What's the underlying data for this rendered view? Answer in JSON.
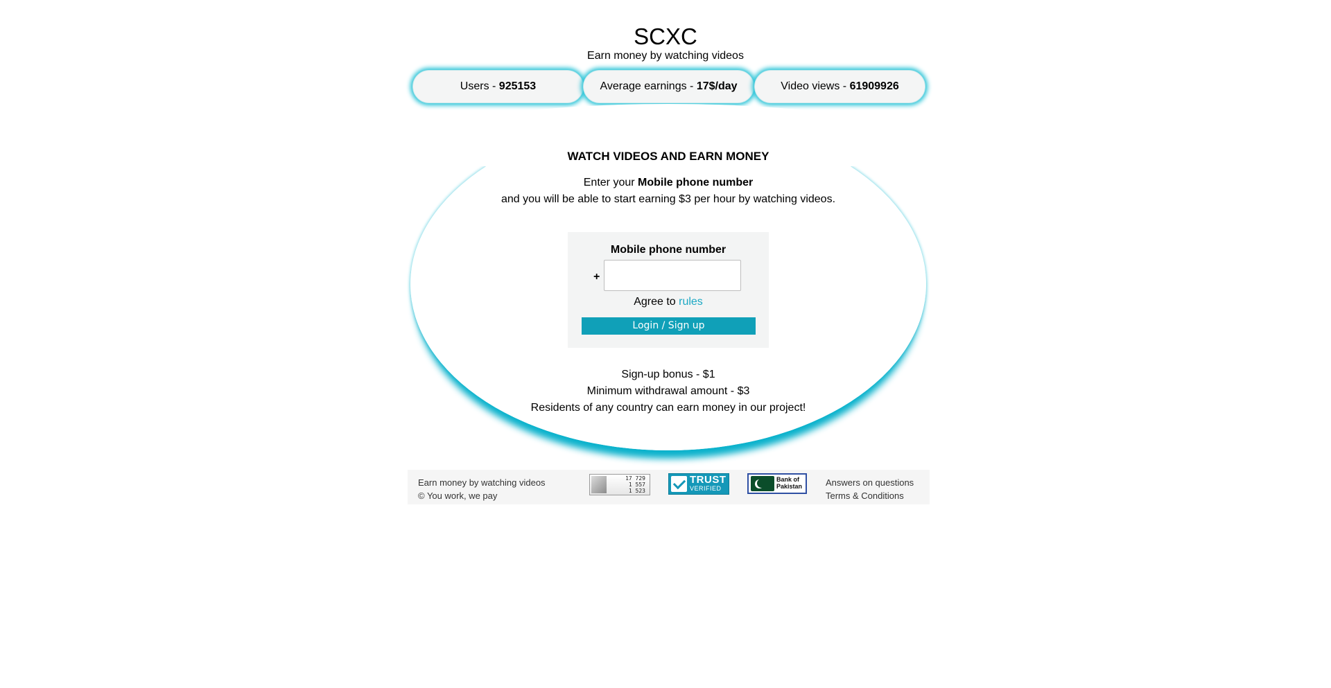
{
  "header": {
    "title": "SCXC",
    "subtitle": "Earn money by watching videos"
  },
  "stats": [
    {
      "label": "Users - ",
      "value": "925153"
    },
    {
      "label": "Average earnings - ",
      "value": "17$/day"
    },
    {
      "label": "Video views - ",
      "value": "61909926"
    }
  ],
  "promo": {
    "heading": "WATCH VIDEOS AND EARN MONEY",
    "intro_prefix": "Enter your ",
    "intro_bold": "Mobile phone number",
    "intro_line2": "and you will be able to start earning $3 per hour by watching videos."
  },
  "form": {
    "label": "Mobile phone number",
    "plus": "+",
    "phone_value": "",
    "agree_prefix": "Agree to ",
    "rules_link": "rules",
    "submit_label": "Login / Sign up"
  },
  "info": [
    "Sign-up bonus - $1",
    "Minimum withdrawal amount - $3",
    "Residents of any country can earn money in our project!"
  ],
  "footer": {
    "tagline": "Earn money by watching videos",
    "copyright": "© You work, we pay",
    "counter": [
      "17 729",
      "1 557",
      "1 523"
    ],
    "trust_word": "TRUST",
    "trust_sub": "VERIFIED",
    "bank_line1": "Bank of",
    "bank_line2": "Pakistan",
    "links": [
      "Answers on questions",
      "Terms & Conditions"
    ]
  },
  "colors": {
    "accent": "#10a0b8",
    "glow": "#23c2d6",
    "link": "#1ba8c4"
  }
}
